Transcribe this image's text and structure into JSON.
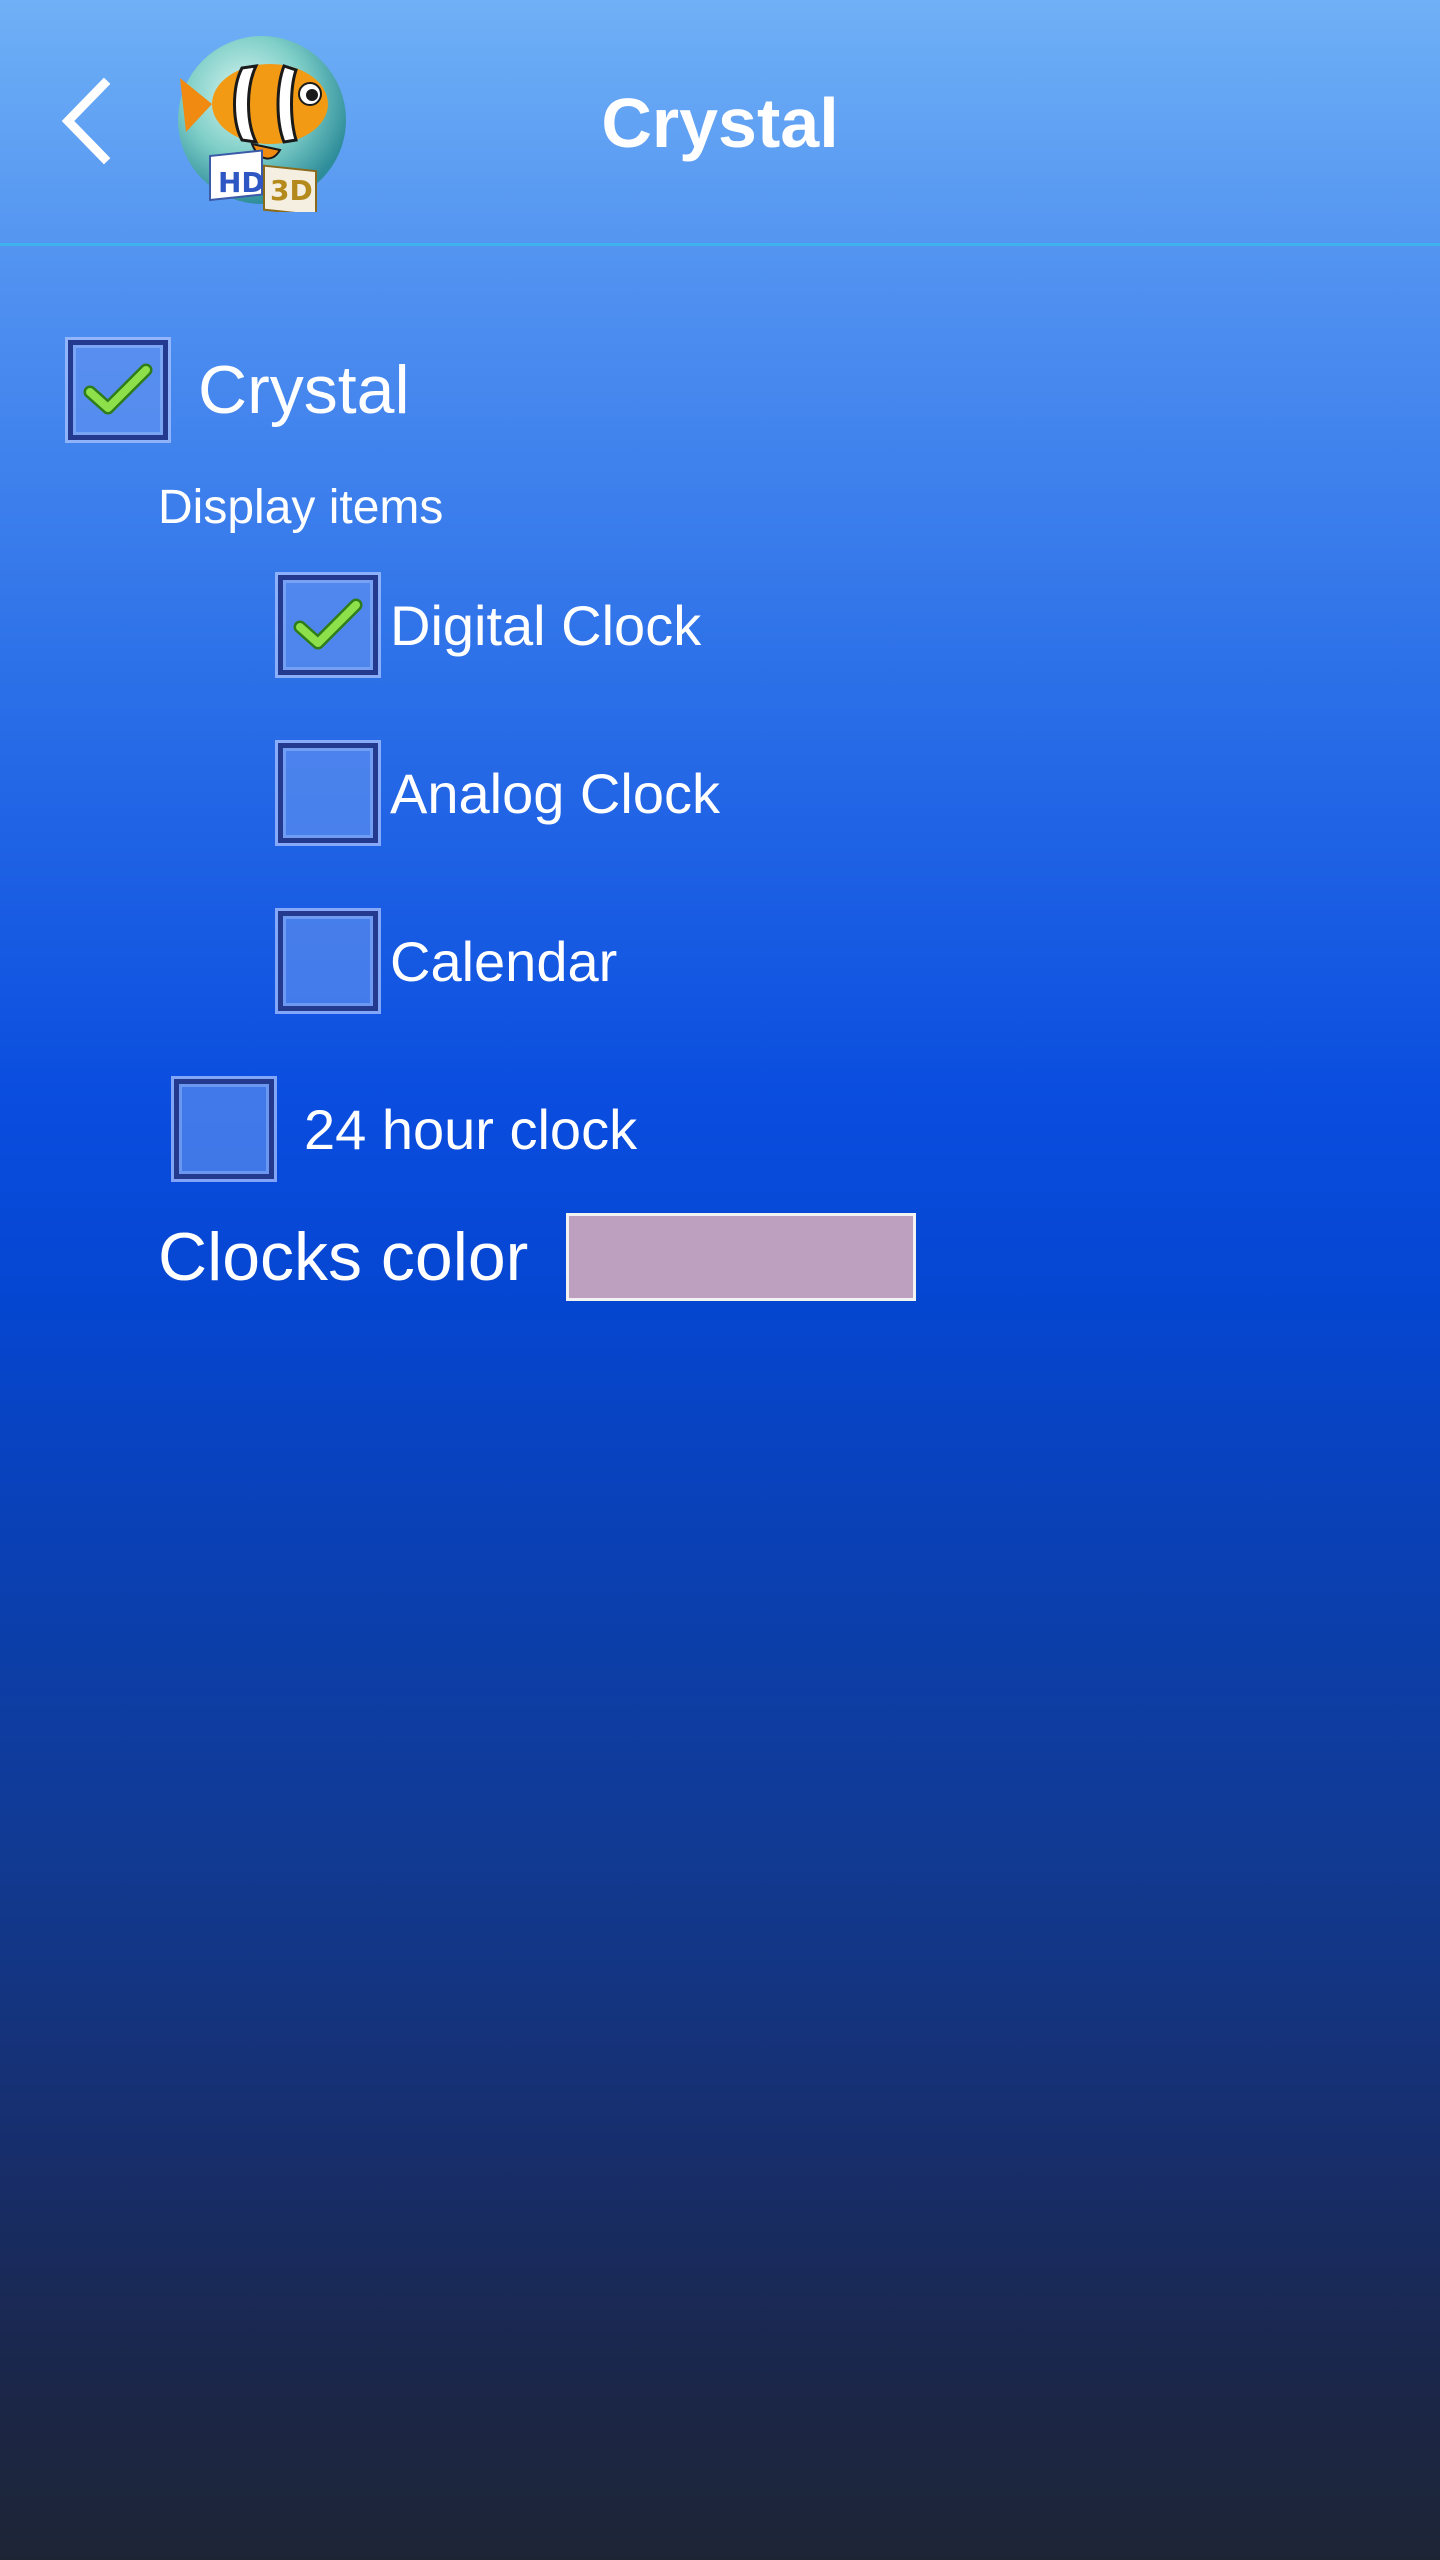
{
  "header": {
    "title": "Crystal",
    "back_icon": "chevron-left-icon",
    "logo_text_hd": "HD",
    "logo_text_3d": "3D",
    "logo_icon": "clownfish-logo-icon"
  },
  "settings": {
    "master": {
      "label": "Crystal",
      "checked": true
    },
    "display_items_label": "Display items",
    "items": [
      {
        "label": "Digital Clock",
        "checked": true
      },
      {
        "label": "Analog Clock",
        "checked": false
      },
      {
        "label": "Calendar",
        "checked": false
      }
    ],
    "hour24": {
      "label": "24 hour clock",
      "checked": false
    },
    "clocks_color": {
      "label": "Clocks color",
      "value": "#bd9fc0"
    }
  },
  "colors": {
    "accent_line": "#3fb2ee",
    "check_green": "#7fd23a",
    "checkbox_border": "#243a8f"
  }
}
